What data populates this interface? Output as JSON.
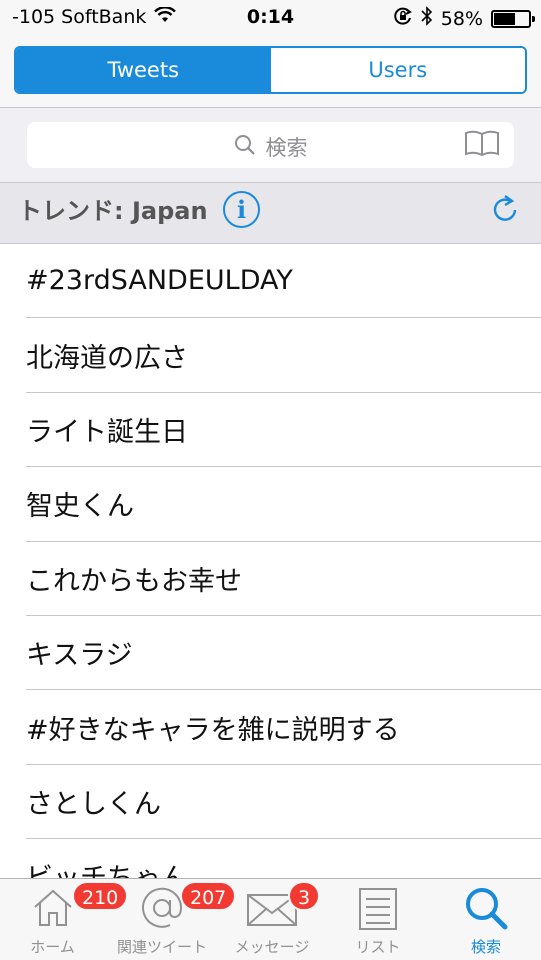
{
  "status": {
    "carrier": "-105 SoftBank",
    "time": "0:14",
    "battery": "58%",
    "battery_level": 0.58
  },
  "segments": {
    "tweets": "Tweets",
    "users": "Users",
    "active": "tweets"
  },
  "search": {
    "placeholder": "検索"
  },
  "trends": {
    "title": "トレンド: Japan",
    "items": [
      "#23rdSANDEULDAY",
      "北海道の広さ",
      "ライト誕生日",
      "智史くん",
      "これからもお幸せ",
      "キスラジ",
      "#好きなキャラを雑に説明する",
      "さとしくん",
      "ビッチちゃん"
    ]
  },
  "tabbar": {
    "home": {
      "label": "ホーム",
      "badge": "210"
    },
    "mentions": {
      "label": "関連ツイート",
      "badge": "207"
    },
    "messages": {
      "label": "メッセージ",
      "badge": "3"
    },
    "lists": {
      "label": "リスト"
    },
    "search": {
      "label": "検索"
    }
  },
  "colors": {
    "accent": "#1a8bdb",
    "badge": "#f23a32"
  }
}
